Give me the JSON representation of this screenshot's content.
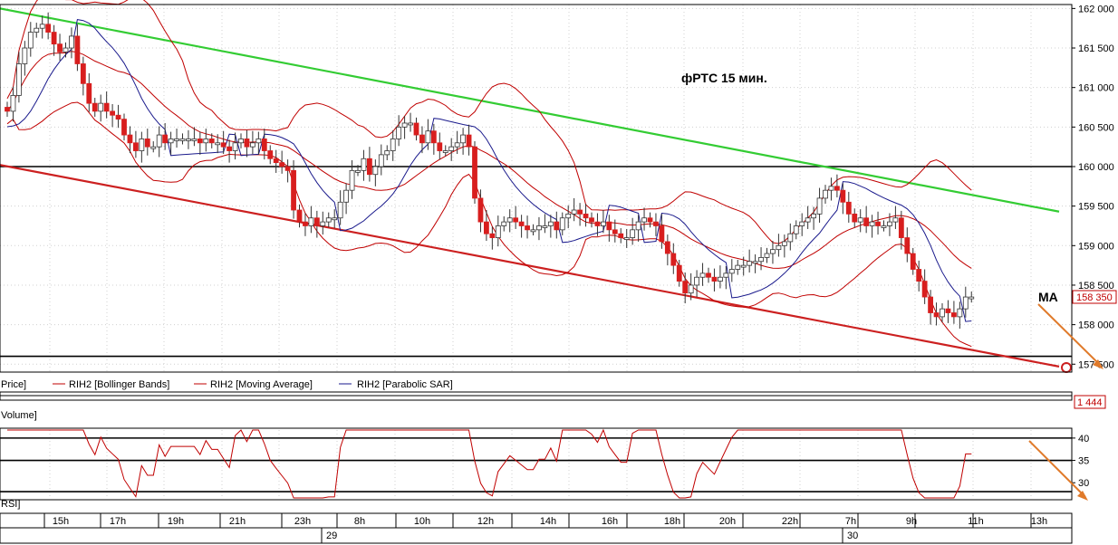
{
  "annotations": {
    "title": "фРТС   15 мин.",
    "ma_label": "MA"
  },
  "price_panel": {
    "y_ticks": [
      "162 000",
      "161 500",
      "161 000",
      "160 500",
      "160 000",
      "159 500",
      "159 000",
      "158 500",
      "158 000",
      "157 500"
    ],
    "current_price_tag": "158 350",
    "legend": [
      {
        "label": "Price]",
        "color": "#c00000"
      },
      {
        "label": "RIH2 [Bollinger Bands]",
        "color": "#c00000"
      },
      {
        "label": "RIH2 [Moving Average]",
        "color": "#c00000"
      },
      {
        "label": "RIH2 [Parabolic SAR]",
        "color": "#1a1a8c"
      }
    ]
  },
  "volume_panel": {
    "label": "Volume]",
    "value_tag": "1 444"
  },
  "rsi_panel": {
    "label": "RSI]",
    "y_ticks": [
      "40",
      "35",
      "30"
    ]
  },
  "time_axis": {
    "hour_labels": [
      "15h",
      "17h",
      "19h",
      "21h",
      "23h",
      "8h",
      "10h",
      "12h",
      "14h",
      "16h",
      "18h",
      "20h",
      "22h",
      "7h",
      "9h",
      "11h",
      "13h"
    ],
    "day_labels": [
      "29",
      "30"
    ]
  },
  "colors": {
    "candle": "#d81e1e",
    "bollinger": "#c00000",
    "sar": "#1a1a8c",
    "upper_trend": "#33cc33",
    "lower_trend": "#cc2020",
    "forecast_arrow": "#e07a2a"
  },
  "chart_data": {
    "type": "candlestick",
    "ylim": [
      157400,
      162050
    ],
    "levels": [
      160000,
      157600
    ],
    "trendlines": [
      {
        "name": "upper",
        "from": {
          "bar": 0,
          "price": 162000
        },
        "to": {
          "bar": 180,
          "price": 159430
        }
      },
      {
        "name": "lower",
        "from": {
          "bar": 0,
          "price": 160020
        },
        "to": {
          "bar": 180,
          "price": 157470
        }
      }
    ],
    "price_series": [
      160700,
      160900,
      161300,
      161500,
      161700,
      161750,
      161800,
      161700,
      161550,
      161450,
      161500,
      161650,
      161300,
      161050,
      160800,
      160700,
      160800,
      160700,
      160650,
      160600,
      160400,
      160300,
      160200,
      160350,
      160250,
      160250,
      160400,
      160300,
      160350,
      160350,
      160350,
      160350,
      160350,
      160300,
      160350,
      160300,
      160300,
      160250,
      160200,
      160300,
      160350,
      160250,
      160300,
      160350,
      160200,
      160100,
      160050,
      160000,
      159950,
      159450,
      159300,
      159250,
      159350,
      159250,
      159300,
      159350,
      159350,
      159550,
      159700,
      159950,
      159950,
      160100,
      159900,
      160000,
      160150,
      160200,
      160350,
      160500,
      160550,
      160550,
      160400,
      160300,
      160450,
      160300,
      160200,
      160200,
      160250,
      160300,
      160400,
      160250,
      159600,
      159300,
      159150,
      159100,
      159250,
      159300,
      159350,
      159300,
      159250,
      159200,
      159200,
      159250,
      159250,
      159300,
      159200,
      159350,
      159400,
      159450,
      159400,
      159350,
      159300,
      159250,
      159300,
      159200,
      159150,
      159100,
      159100,
      159200,
      159300,
      159350,
      159300,
      159250,
      159050,
      158900,
      158750,
      158550,
      158400,
      158500,
      158600,
      158650,
      158600,
      158550,
      158600,
      158650,
      158700,
      158750,
      158750,
      158800,
      158800,
      158850,
      158900,
      158950,
      159000,
      159050,
      159150,
      159250,
      159300,
      159350,
      159400,
      159600,
      159700,
      159750,
      159700,
      159550,
      159400,
      159300,
      159350,
      159250,
      159300,
      159250,
      159250,
      159300,
      159350,
      159100,
      158900,
      158700,
      158550,
      158350,
      158150,
      158100,
      158200,
      158150,
      158100,
      158200,
      158350,
      158350
    ],
    "rsi": {
      "ylim": [
        26.6,
        41.8
      ],
      "levels": [
        40,
        35,
        28
      ]
    },
    "volume": {
      "last": 1444
    }
  }
}
